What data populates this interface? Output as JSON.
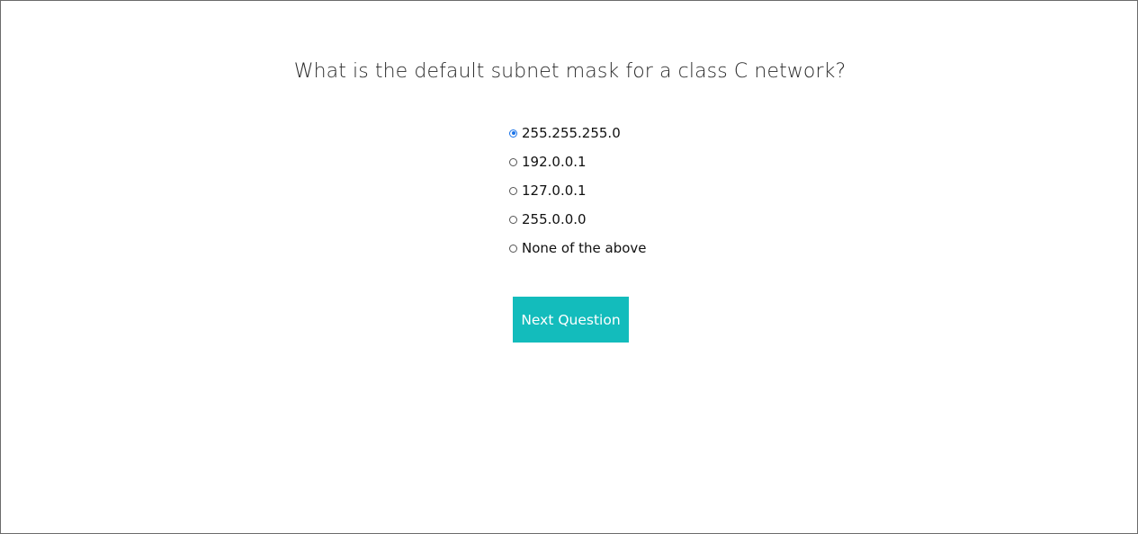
{
  "quiz": {
    "question": "What is the default subnet mask for a class C network?",
    "options": [
      {
        "label": "255.255.255.0",
        "selected": true
      },
      {
        "label": "192.0.0.1",
        "selected": false
      },
      {
        "label": "127.0.0.1",
        "selected": false
      },
      {
        "label": "255.0.0.0",
        "selected": false
      },
      {
        "label": "None of the above",
        "selected": false
      }
    ],
    "next_button_label": "Next Question"
  },
  "colors": {
    "button_bg": "#13bcbc",
    "radio_selected": "#1a73e8",
    "border": "#6b6b6b"
  }
}
